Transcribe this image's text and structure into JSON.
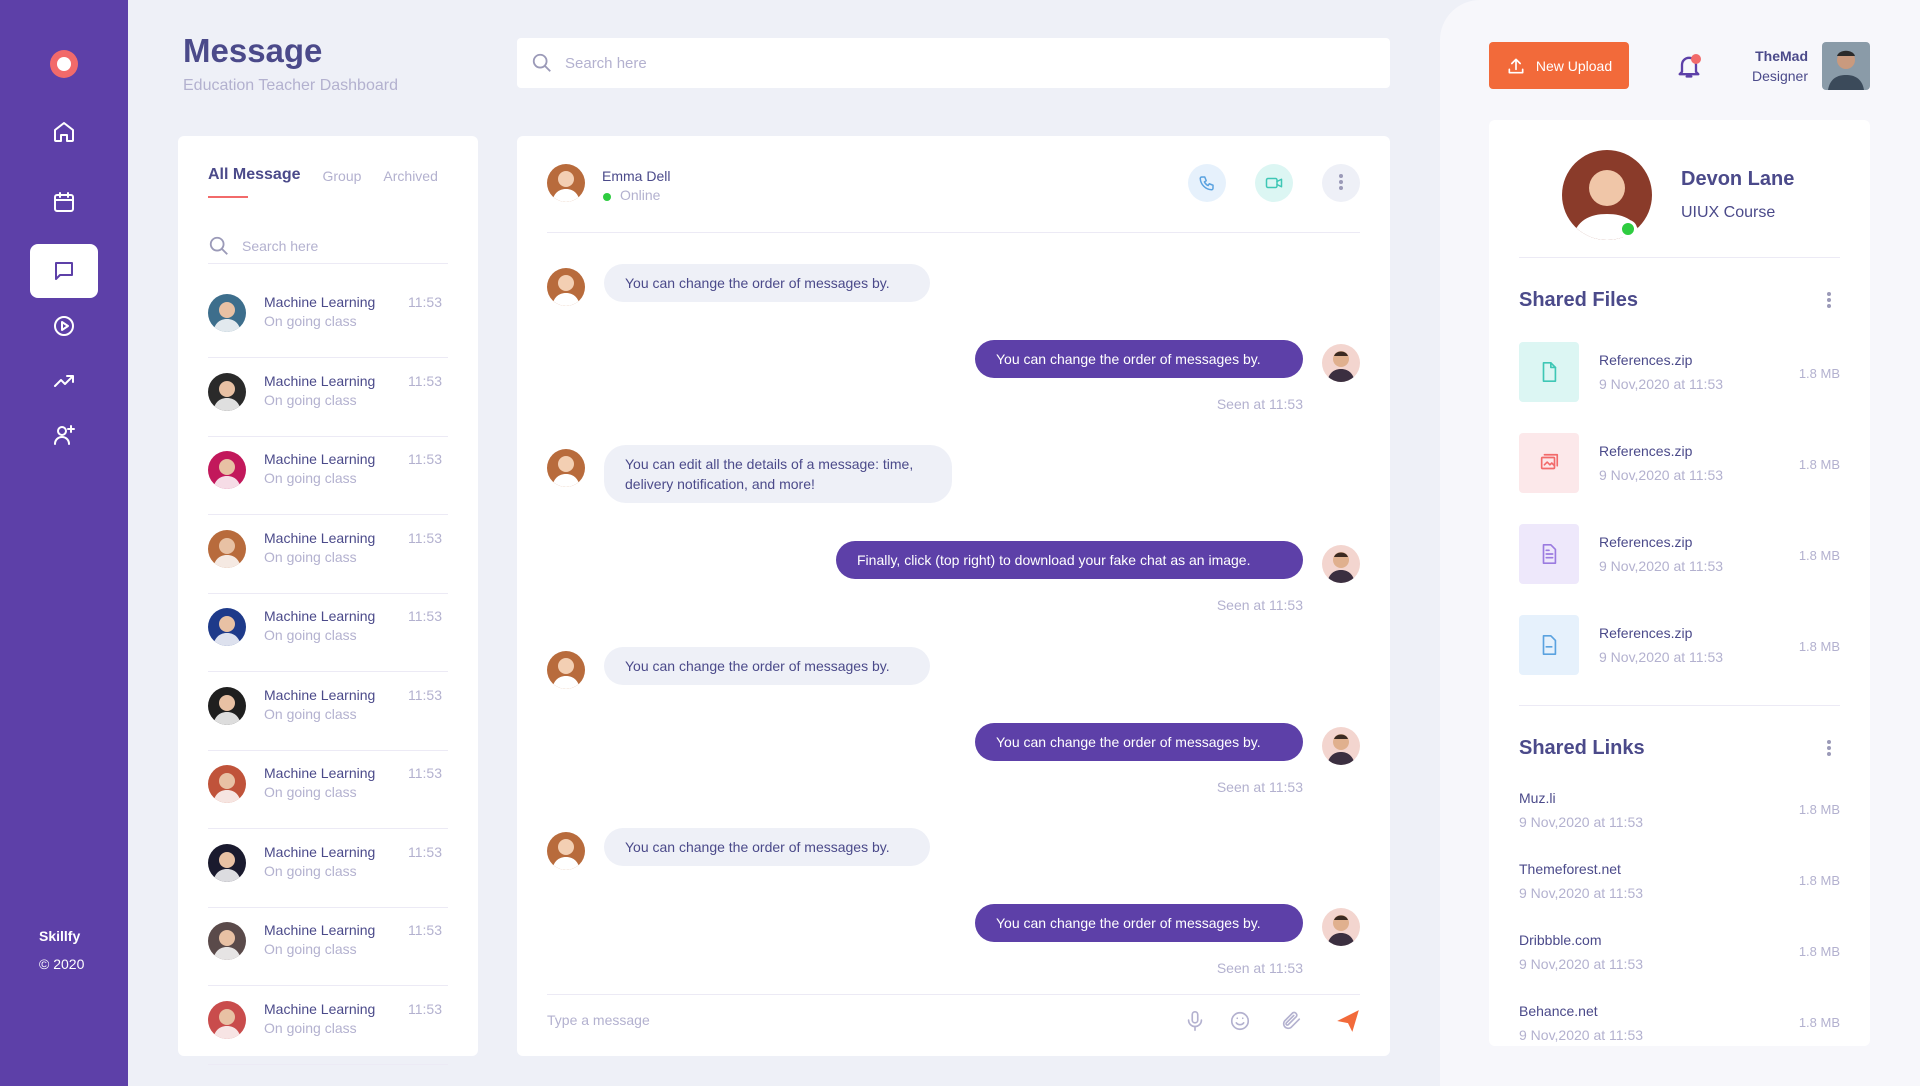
{
  "sidebar": {
    "brand": "Skillfy",
    "copyright": "© 2020",
    "nav": [
      {
        "name": "home-icon",
        "active": false
      },
      {
        "name": "calendar-icon",
        "active": false
      },
      {
        "name": "message-icon",
        "active": true
      },
      {
        "name": "play-icon",
        "active": false
      },
      {
        "name": "trending-icon",
        "active": false
      },
      {
        "name": "user-add-icon",
        "active": false
      }
    ]
  },
  "header": {
    "title": "Message",
    "subtitle": "Education Teacher Dashboard",
    "search_placeholder": "Search here"
  },
  "conversations": {
    "tabs": [
      "All Message",
      "Group",
      "Archived"
    ],
    "search_placeholder": "Search here",
    "items": [
      {
        "name": "Machine Learning",
        "status": "On going class",
        "time": "11:53",
        "color": "#3d6e8c"
      },
      {
        "name": "Machine Learning",
        "status": "On going class",
        "time": "11:53",
        "color": "#2a2a2a"
      },
      {
        "name": "Machine Learning",
        "status": "On going class",
        "time": "11:53",
        "color": "#c2185b"
      },
      {
        "name": "Machine Learning",
        "status": "On going class",
        "time": "11:53",
        "color": "#b86b3c"
      },
      {
        "name": "Machine Learning",
        "status": "On going class",
        "time": "11:53",
        "color": "#1e3a8a"
      },
      {
        "name": "Machine Learning",
        "status": "On going class",
        "time": "11:53",
        "color": "#1f1f1f"
      },
      {
        "name": "Machine Learning",
        "status": "On going class",
        "time": "11:53",
        "color": "#c0533a"
      },
      {
        "name": "Machine Learning",
        "status": "On going class",
        "time": "11:53",
        "color": "#1a1a2e"
      },
      {
        "name": "Machine Learning",
        "status": "On going class",
        "time": "11:53",
        "color": "#5a4a4a"
      },
      {
        "name": "Machine Learning",
        "status": "On going class",
        "time": "11:53",
        "color": "#c94c4c"
      }
    ]
  },
  "chat": {
    "contact_name": "Emma Dell",
    "contact_status": "Online",
    "messages": [
      {
        "dir": "in",
        "text": "You can change the order of messages by."
      },
      {
        "dir": "out",
        "text": "You can change the order of messages by.",
        "seen": "Seen at 11:53"
      },
      {
        "dir": "in",
        "text": "You can edit all the details of a message: time, delivery notification, and more!"
      },
      {
        "dir": "out",
        "text": "Finally, click  (top right) to download your fake chat as an image.",
        "seen": "Seen at 11:53"
      },
      {
        "dir": "in",
        "text": "You can change the order of messages by."
      },
      {
        "dir": "out",
        "text": "You can change the order of messages by.",
        "seen": "Seen at 11:53"
      },
      {
        "dir": "in",
        "text": "You can change the order of messages by."
      },
      {
        "dir": "out",
        "text": "You can change the order of messages by.",
        "seen": "Seen at 11:53"
      }
    ],
    "input_placeholder": "Type a message"
  },
  "topbar": {
    "upload_label": "New Upload",
    "user_name": "TheMad",
    "user_role": "Designer"
  },
  "profile": {
    "name": "Devon Lane",
    "course": "UIUX Course"
  },
  "shared_files": {
    "title": "Shared Files",
    "items": [
      {
        "name": "References.zip",
        "date": "9 Nov,2020 at 11:53",
        "size": "1.8 MB",
        "bg": "#dcf6f3",
        "fg": "#3ec7b5",
        "icon": "file-icon"
      },
      {
        "name": "References.zip",
        "date": "9 Nov,2020 at 11:53",
        "size": "1.8 MB",
        "bg": "#fce8ea",
        "fg": "#f26a6a",
        "icon": "gallery-icon"
      },
      {
        "name": "References.zip",
        "date": "9 Nov,2020 at 11:53",
        "size": "1.8 MB",
        "bg": "#eee8fb",
        "fg": "#9b7be0",
        "icon": "document-icon"
      },
      {
        "name": "References.zip",
        "date": "9 Nov,2020 at 11:53",
        "size": "1.8 MB",
        "bg": "#e6f1fc",
        "fg": "#5aa2e0",
        "icon": "pdf-icon"
      }
    ]
  },
  "shared_links": {
    "title": "Shared Links",
    "items": [
      {
        "name": "Muz.li",
        "date": "9 Nov,2020 at 11:53",
        "size": "1.8 MB"
      },
      {
        "name": "Themeforest.net",
        "date": "9 Nov,2020 at 11:53",
        "size": "1.8 MB"
      },
      {
        "name": "Dribbble.com",
        "date": "9 Nov,2020 at 11:53",
        "size": "1.8 MB"
      },
      {
        "name": "Behance.net",
        "date": "9 Nov,2020 at 11:53",
        "size": "1.8 MB"
      }
    ]
  },
  "colors": {
    "primary": "#5d40a8",
    "accent": "#f26a3a",
    "online": "#2ecc40",
    "background": "#eef0f7"
  }
}
